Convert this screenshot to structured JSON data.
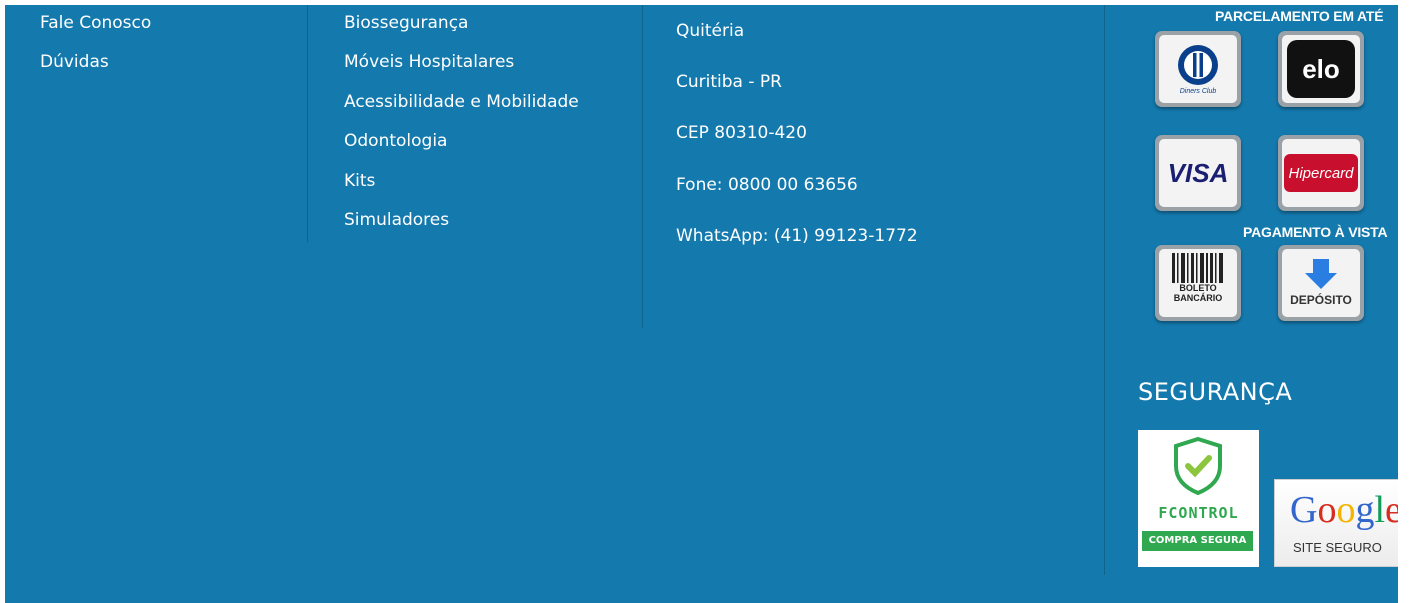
{
  "col1": {
    "links": [
      "Fale Conosco",
      "Dúvidas"
    ]
  },
  "col2": {
    "links": [
      "Biossegurança",
      "Móveis Hospitalares",
      "Acessibilidade e Mobilidade",
      "Odontologia",
      "Kits",
      "Simuladores"
    ]
  },
  "col3": {
    "lines": [
      "Quitéria",
      "Curitiba - PR",
      "CEP 80310-420",
      "Fone: 0800 00 63656",
      "WhatsApp: (41) 99123-1772"
    ]
  },
  "payments": {
    "installments_label": "PARCELAMENTO EM ATÉ",
    "cash_label": "PAGAMENTO À VISTA",
    "cards": {
      "diners": "Diners Club",
      "elo": "elo",
      "visa": "VISA",
      "hipercard": "Hipercard",
      "boleto_1": "BOLETO",
      "boleto_2": "BANCÁRIO",
      "deposito": "DEPÓSITO"
    }
  },
  "security": {
    "title": "SEGURANÇA",
    "fcontrol_brand": "FCONTROL",
    "fcontrol_sub": "COMPRA SEGURA",
    "google_brand": "Google",
    "google_sub": "SITE SEGURO"
  },
  "colors": {
    "footer_bg": "#1479ad",
    "text": "#ffffff"
  }
}
